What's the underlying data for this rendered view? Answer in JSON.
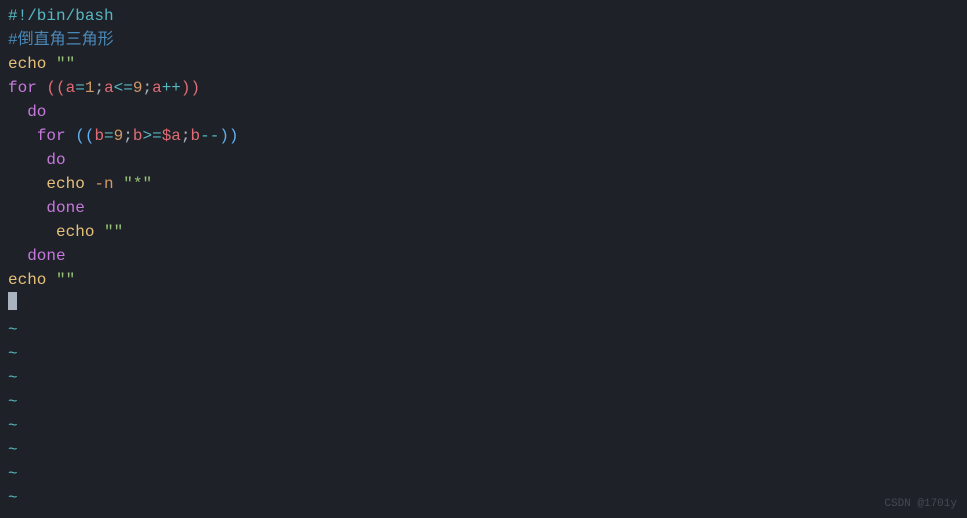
{
  "editor": {
    "lines": {
      "line1": {
        "shebang": "#!/bin/bash"
      },
      "line2": {
        "comment_prefix": "#",
        "comment_text": "倒直角三角形"
      },
      "line3": {
        "echo": "echo",
        "sp": " ",
        "str": "\"\""
      },
      "line4": {
        "for": "for",
        "sp": " ",
        "po": "((",
        "var_a": "a",
        "eq": "=",
        "num1": "1",
        "semi1": ";",
        "var_a2": "a",
        "le": "<=",
        "num9": "9",
        "semi2": ";",
        "var_a3": "a",
        "inc": "++",
        "pc": "))"
      },
      "line5": {
        "indent": "  ",
        "do": "do"
      },
      "line6": {
        "indent": "   ",
        "for": "for",
        "sp": " ",
        "po": "((",
        "var_b": "b",
        "eq": "=",
        "num9": "9",
        "semi1": ";",
        "var_b2": "b",
        "ge": ">=",
        "dollar_a": "$a",
        "semi2": ";",
        "var_b3": "b",
        "dec": "--",
        "pc": "))"
      },
      "line7": {
        "indent": "    ",
        "do": "do"
      },
      "line8": {
        "indent": "    ",
        "echo": "echo",
        "sp": " ",
        "flag": "-n",
        "sp2": " ",
        "str": "\"*\""
      },
      "line9": {
        "indent": "    ",
        "done": "done"
      },
      "line10": {
        "indent": "     ",
        "echo": "echo",
        "sp": " ",
        "str": "\"\""
      },
      "line11": {
        "indent": "  ",
        "done": "done"
      },
      "line12": {
        "echo": "echo",
        "sp": " ",
        "str": "\"\""
      },
      "tilde": "~"
    }
  },
  "watermark": "CSDN @1701y"
}
